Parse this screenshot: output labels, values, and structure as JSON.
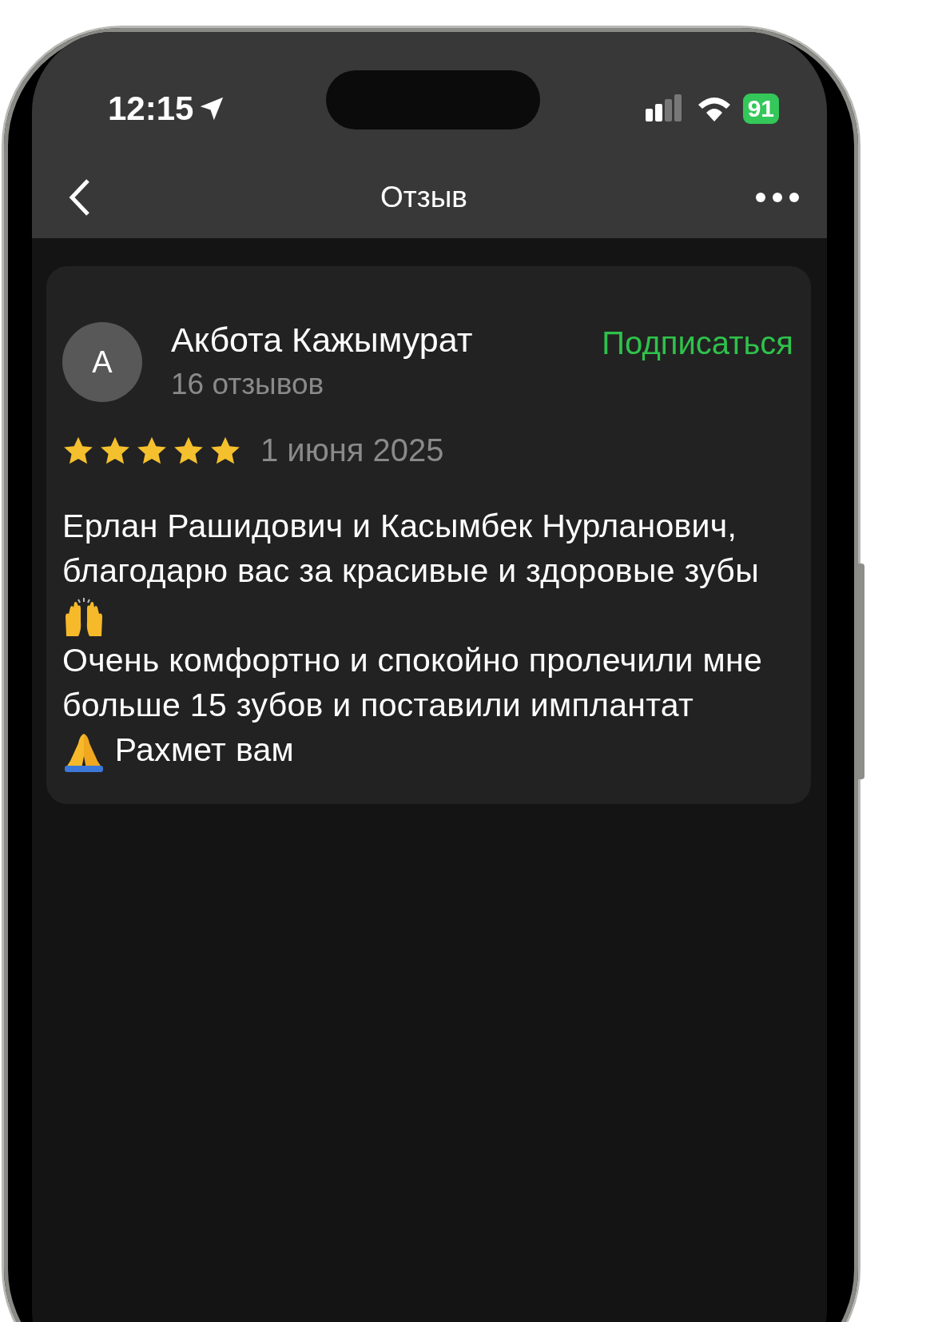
{
  "status_bar": {
    "time": "12:15",
    "battery": "91"
  },
  "header": {
    "title": "Отзыв"
  },
  "review": {
    "author": {
      "initial": "А",
      "name": "Акбота Кажымурат",
      "reviews_count": "16 отзывов"
    },
    "subscribe": "Подписаться",
    "stars": 5,
    "date": "1 июня 2025",
    "body": [
      {
        "kind": "text",
        "text": "Ерлан Рашидович и Касымбек Нурланович, благодарю вас за красивые и здоровые зубы"
      },
      {
        "kind": "break"
      },
      {
        "kind": "raised-hands"
      },
      {
        "kind": "break"
      },
      {
        "kind": "text",
        "text": "Очень комфортно и спокойно пролечили мне больше 15 зубов и поставили имплантат"
      },
      {
        "kind": "break"
      },
      {
        "kind": "folded-hands"
      },
      {
        "kind": "text",
        "text": " Рахмет вам"
      }
    ]
  }
}
